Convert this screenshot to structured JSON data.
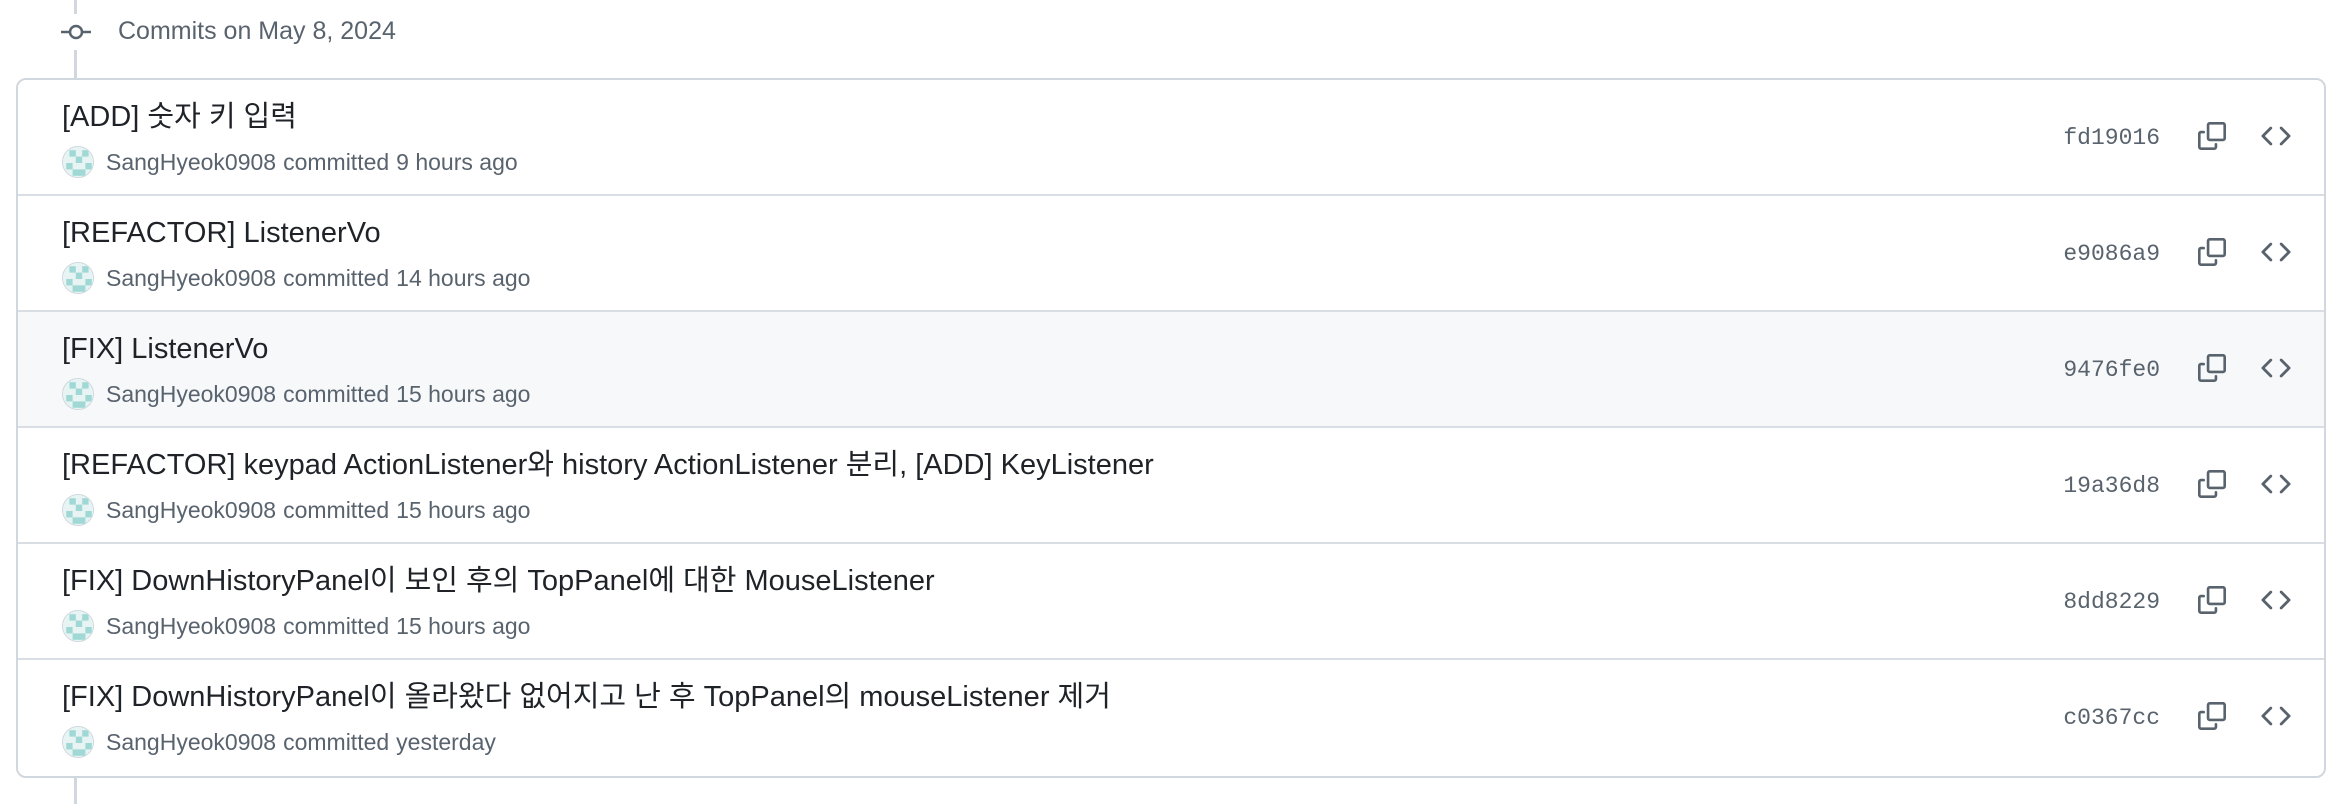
{
  "group": {
    "title": "Commits on May 8, 2024"
  },
  "commits": [
    {
      "message": "[ADD] 숫자 키 입력",
      "author": "SangHyeok0908",
      "action": "committed",
      "time": "9 hours ago",
      "sha": "fd19016"
    },
    {
      "message": "[REFACTOR] ListenerVo",
      "author": "SangHyeok0908",
      "action": "committed",
      "time": "14 hours ago",
      "sha": "e9086a9"
    },
    {
      "message": "[FIX] ListenerVo",
      "author": "SangHyeok0908",
      "action": "committed",
      "time": "15 hours ago",
      "sha": "9476fe0"
    },
    {
      "message": "[REFACTOR] keypad ActionListener와 history ActionListener 분리, [ADD] KeyListener",
      "author": "SangHyeok0908",
      "action": "committed",
      "time": "15 hours ago",
      "sha": "19a36d8"
    },
    {
      "message": "[FIX] DownHistoryPanel이 보인 후의 TopPanel에 대한 MouseListener",
      "author": "SangHyeok0908",
      "action": "committed",
      "time": "15 hours ago",
      "sha": "8dd8229"
    },
    {
      "message": "[FIX] DownHistoryPanel이 올라왔다 없어지고 난 후 TopPanel의 mouseListener 제거",
      "author": "SangHyeok0908",
      "action": "committed",
      "time": "yesterday",
      "sha": "c0367cc"
    }
  ],
  "icons": {
    "timeline_node": "git-commit-icon",
    "copy": "copy-icon",
    "browse": "code-icon",
    "avatar": "identicon-avatar"
  },
  "colors": {
    "text_primary": "#1f2328",
    "text_muted": "#59636e",
    "border": "#d0d7de",
    "row_hover_bg": "#f6f8fa",
    "avatar_tint": "#9fd8d4"
  },
  "state": {
    "hovered_row": 2
  }
}
